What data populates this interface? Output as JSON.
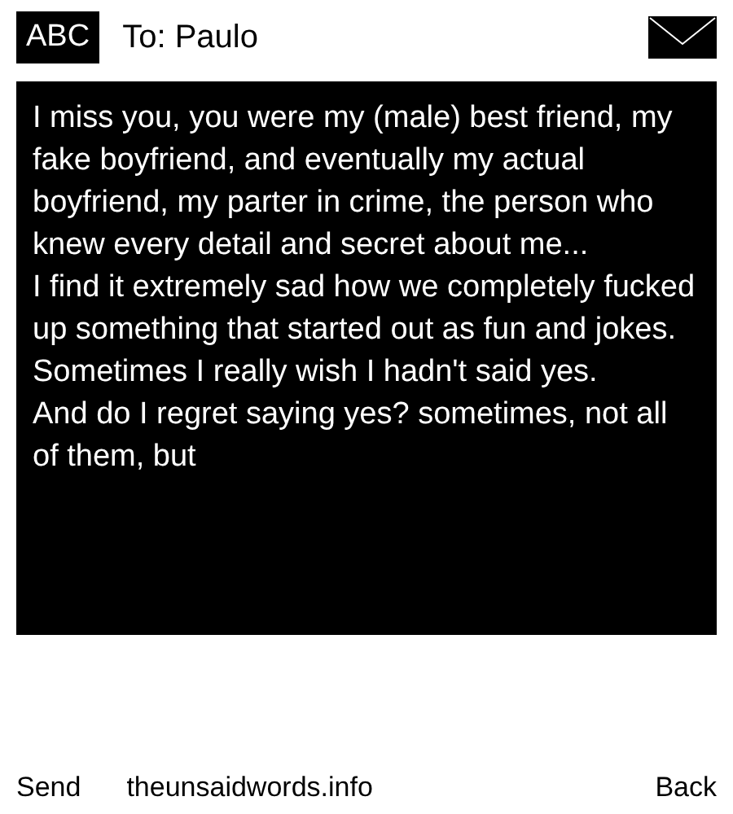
{
  "header": {
    "input_mode": "ABC",
    "recipient": "To: Paulo"
  },
  "message": {
    "paragraphs": [
      "I miss you, you were my (male) best friend, my fake boyfriend, and eventually my actual boyfriend, my parter in crime, the person who knew every detail and secret about me...",
      "I find it extremely sad how we completely fucked up something that started out as fun and jokes.",
      "Sometimes I really wish I hadn't said yes.",
      "And do I regret saying yes? sometimes, not all of them, but"
    ]
  },
  "softkeys": {
    "left": "Send",
    "center": "theunsaidwords.info",
    "right": "Back"
  }
}
